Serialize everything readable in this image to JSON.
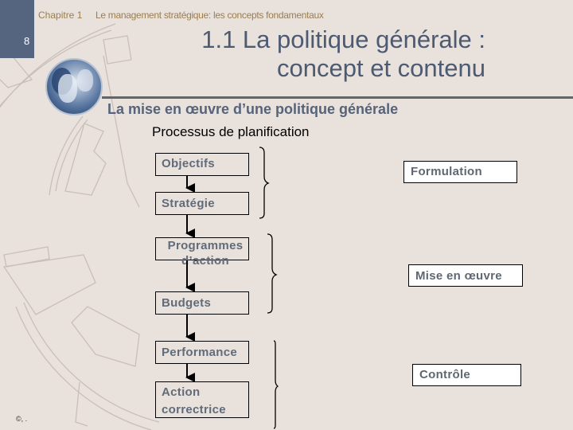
{
  "header": {
    "page_number": "8",
    "chapter_label": "Chapitre 1",
    "chapter_title": "Le management stratégique: les concepts fondamentaux"
  },
  "slide": {
    "title": "1.1 La politique générale : concept et contenu",
    "section_heading": "La mise en œuvre d’une politique générale",
    "subheading": "Processus de planification"
  },
  "diagram": {
    "steps": [
      {
        "label": "Objectifs"
      },
      {
        "label": "Stratégie"
      },
      {
        "label": "Programmes d’action"
      },
      {
        "label": "Budgets"
      },
      {
        "label": "Performance"
      },
      {
        "label": "Action correctrice"
      }
    ],
    "phases": [
      {
        "label": "Formulation",
        "covers_steps": [
          "Objectifs",
          "Stratégie"
        ]
      },
      {
        "label": "Mise en œuvre",
        "covers_steps": [
          "Programmes d’action",
          "Budgets"
        ]
      },
      {
        "label": "Contrôle",
        "covers_steps": [
          "Performance",
          "Action correctrice"
        ]
      }
    ],
    "colors": {
      "box_text": "#616b7a",
      "arrow": "#000000",
      "phase_box_fill": "#ffffff"
    }
  },
  "footer": {
    "copyright": "©, ."
  },
  "colors": {
    "background": "#e9e1db",
    "side_panel": "#56657f",
    "title_text": "#4c5a72",
    "header_text": "#9c7e4c"
  }
}
